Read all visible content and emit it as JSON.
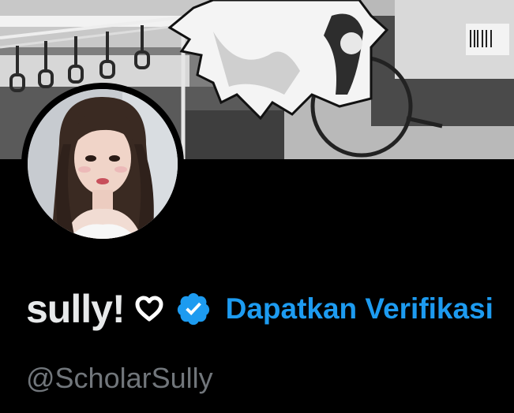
{
  "profile": {
    "display_name": "sully!",
    "name_emoji_icon": "heart-icon",
    "verified_badge_icon": "verified-badge-icon",
    "get_verified_link": "Dapatkan Verifikasi",
    "handle": "@ScholarSully"
  },
  "colors": {
    "background": "#000000",
    "name_text": "#e7e9ea",
    "handle_text": "#71767b",
    "accent_blue": "#1d9bf0"
  }
}
